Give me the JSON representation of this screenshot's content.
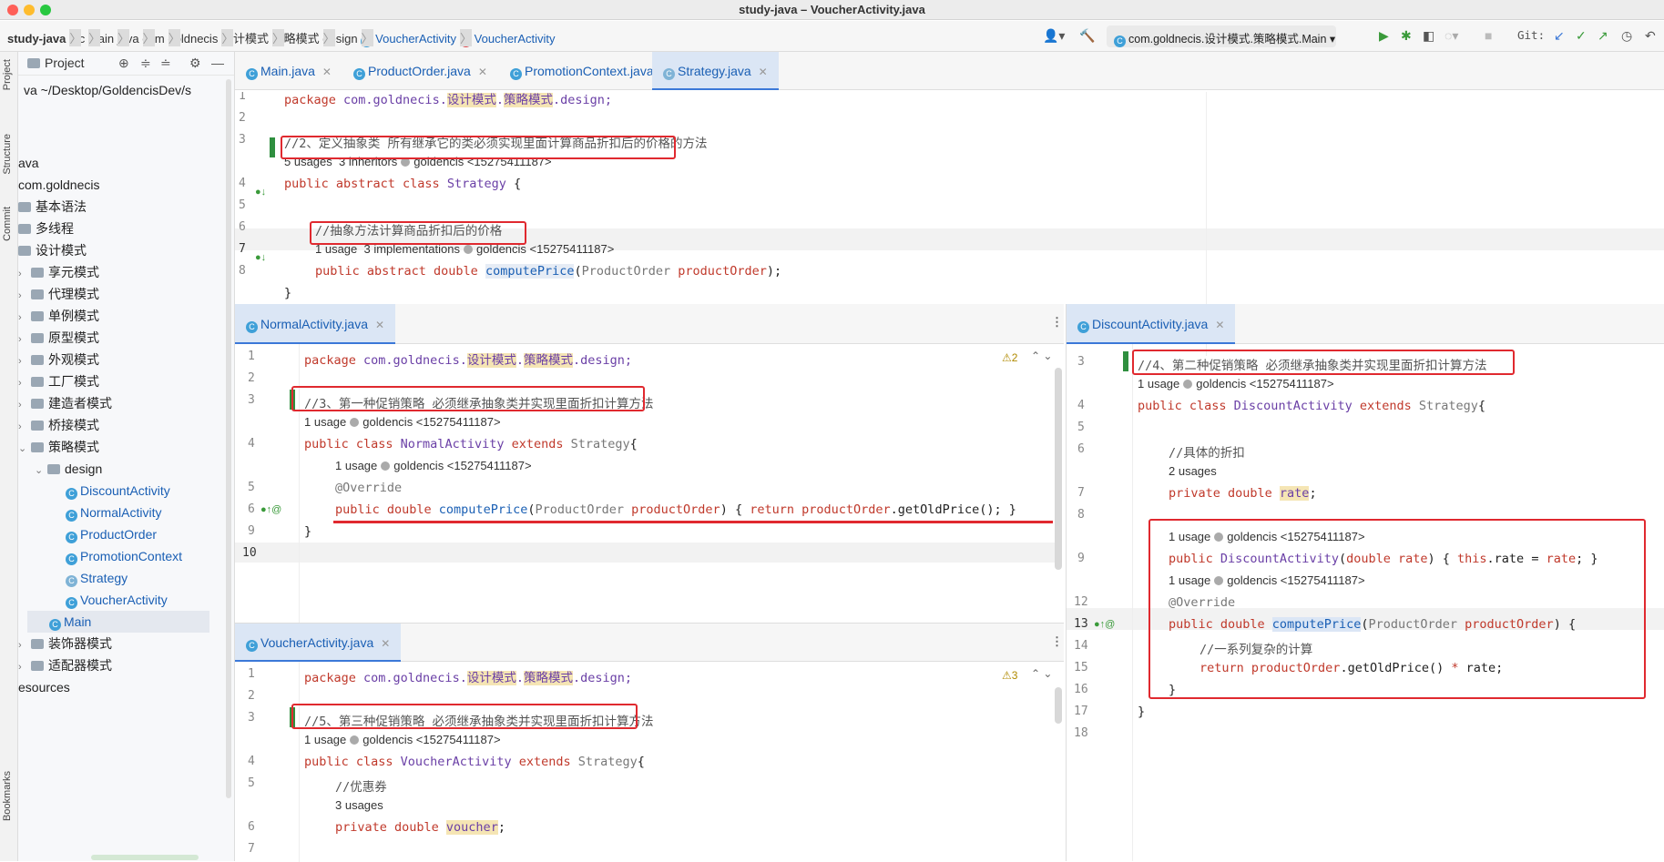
{
  "window": {
    "title": "study-java – VoucherActivity.java"
  },
  "breadcrumb": [
    "study-java",
    "src",
    "main",
    "java",
    "com",
    "goldnecis",
    "设计模式",
    "策略模式",
    "design",
    "VoucherActivity",
    "VoucherActivity"
  ],
  "run_config": "com.goldnecis.设计模式.策略模式.Main",
  "git_label": "Git:",
  "sidebar_labels": {
    "project": "Project",
    "structure": "Structure",
    "commit": "Commit",
    "bookmarks": "Bookmarks"
  },
  "project": {
    "header": "Project",
    "root_path": "va  ~/Desktop/GoldencisDev/s",
    "items": [
      {
        "label": "ava"
      },
      {
        "label": "com.goldnecis"
      },
      {
        "label": "基本语法"
      },
      {
        "label": "多线程"
      },
      {
        "label": "设计模式"
      },
      {
        "label": "享元模式"
      },
      {
        "label": "代理模式"
      },
      {
        "label": "单例模式"
      },
      {
        "label": "原型模式"
      },
      {
        "label": "外观模式"
      },
      {
        "label": "工厂模式"
      },
      {
        "label": "建造者模式"
      },
      {
        "label": "桥接模式"
      },
      {
        "label": "策略模式"
      },
      {
        "label": "design"
      },
      {
        "label": "DiscountActivity"
      },
      {
        "label": "NormalActivity"
      },
      {
        "label": "ProductOrder"
      },
      {
        "label": "PromotionContext"
      },
      {
        "label": "Strategy"
      },
      {
        "label": "VoucherActivity"
      },
      {
        "label": "Main"
      },
      {
        "label": "装饰器模式"
      },
      {
        "label": "适配器模式"
      },
      {
        "label": "esources"
      }
    ]
  },
  "top_tabs": [
    "Main.java",
    "ProductOrder.java",
    "PromotionContext.java",
    "Strategy.java"
  ],
  "strategy": {
    "ln": [
      "1",
      "2",
      "3",
      "4",
      "5",
      "6",
      "7",
      "8"
    ],
    "pkg": "package ",
    "pkg1": "com.goldnecis.",
    "pkg2": "设计模式",
    "pkg3": "策略模式",
    "pkg4": ".design;",
    "c3": "//2、定义抽象类 所有继承它的类必须实现里面计算商品折扣后的价格的方法",
    "h3": "5 usages  3 inheritors",
    "author": "goldencis <15275411187>",
    "l4a": "public abstract class ",
    "l4b": "Strategy",
    "l4c": " {",
    "c6": "//抽象方法计算商品折扣后的价格",
    "h6": "1 usage  3 implementations",
    "l7a": "public abstract double ",
    "l7b": "computePrice",
    "l7c": "(",
    "l7d": "ProductOrder ",
    "l7e": "productOrder",
    "l7f": ");",
    "l8": "}"
  },
  "normal": {
    "tab": "NormalActivity.java",
    "ln": [
      "1",
      "2",
      "3",
      "4",
      "5",
      "6",
      "9",
      "10"
    ],
    "c3": "//3、第一种促销策略 必须继承抽象类并实现里面折扣计算方法",
    "h3": "1 usage",
    "author": "goldencis <15275411187>",
    "l4a": "public class ",
    "l4b": "NormalActivity",
    "l4c": " extends ",
    "l4d": "Strategy",
    "l4e": "{",
    "h5": "1 usage",
    "ann": "@Override",
    "l6a": "public double ",
    "l6b": "computePrice",
    "l6c": "(",
    "l6d": "ProductOrder ",
    "l6e": "productOrder",
    "l6f": ") { ",
    "l6g": "return ",
    "l6h": "productOrder",
    "l6i": ".getOldPrice(); }",
    "l9": "}",
    "warn": "⚠2"
  },
  "voucher": {
    "tab": "VoucherActivity.java",
    "ln": [
      "1",
      "2",
      "3",
      "4",
      "5",
      "6",
      "7"
    ],
    "c3": "//5、第三种促销策略 必须继承抽象类并实现里面折扣计算方法",
    "h3": "1 usage",
    "author": "goldencis <15275411187>",
    "l4a": "public class ",
    "l4b": "VoucherActivity",
    "l4c": " extends ",
    "l4d": "Strategy",
    "l4e": "{",
    "c5": "//优惠券",
    "h5": "3 usages",
    "l6a": "private double ",
    "l6b": "voucher",
    "l6c": ";",
    "warn": "⚠3"
  },
  "discount": {
    "tab": "DiscountActivity.java",
    "ln": [
      "3",
      "4",
      "5",
      "6",
      "7",
      "8",
      "9",
      "12",
      "13",
      "14",
      "15",
      "16",
      "17",
      "18"
    ],
    "c3": "//4、第二种促销策略 必须继承抽象类并实现里面折扣计算方法",
    "h3": "1 usage",
    "author": "goldencis <15275411187>",
    "l4a": "public class ",
    "l4b": "DiscountActivity",
    "l4c": " extends ",
    "l4d": "Strategy",
    "l4e": "{",
    "c6": "//具体的折扣",
    "h6": "2 usages",
    "l7a": "private double ",
    "l7b": "rate",
    "l7c": ";",
    "h9": "1 usage",
    "l9a": "public ",
    "l9b": "DiscountActivity",
    "l9c": "(",
    "l9d": "double ",
    "l9e": "rate",
    "l9f": ") { ",
    "l9g": "this",
    "l9h": ".rate = ",
    "l9i": "rate",
    "l9j": "; }",
    "h12": "1 usage",
    "ann": "@Override",
    "l13a": "public double ",
    "l13b": "computePrice",
    "l13c": "(",
    "l13d": "ProductOrder ",
    "l13e": "productOrder",
    "l13f": ") {",
    "c14": "//一系列复杂的计算",
    "l15a": "return ",
    "l15b": "productOrder",
    "l15c": ".getOldPrice() ",
    "l15d": "*",
    "l15e": " rate;",
    "l16": "}",
    "l17": "}"
  },
  "colors": {
    "accent": "#3b78d8",
    "annotation_box": "#e0292f",
    "keyword": "#c0392b",
    "class_name": "#6a3fa6"
  }
}
